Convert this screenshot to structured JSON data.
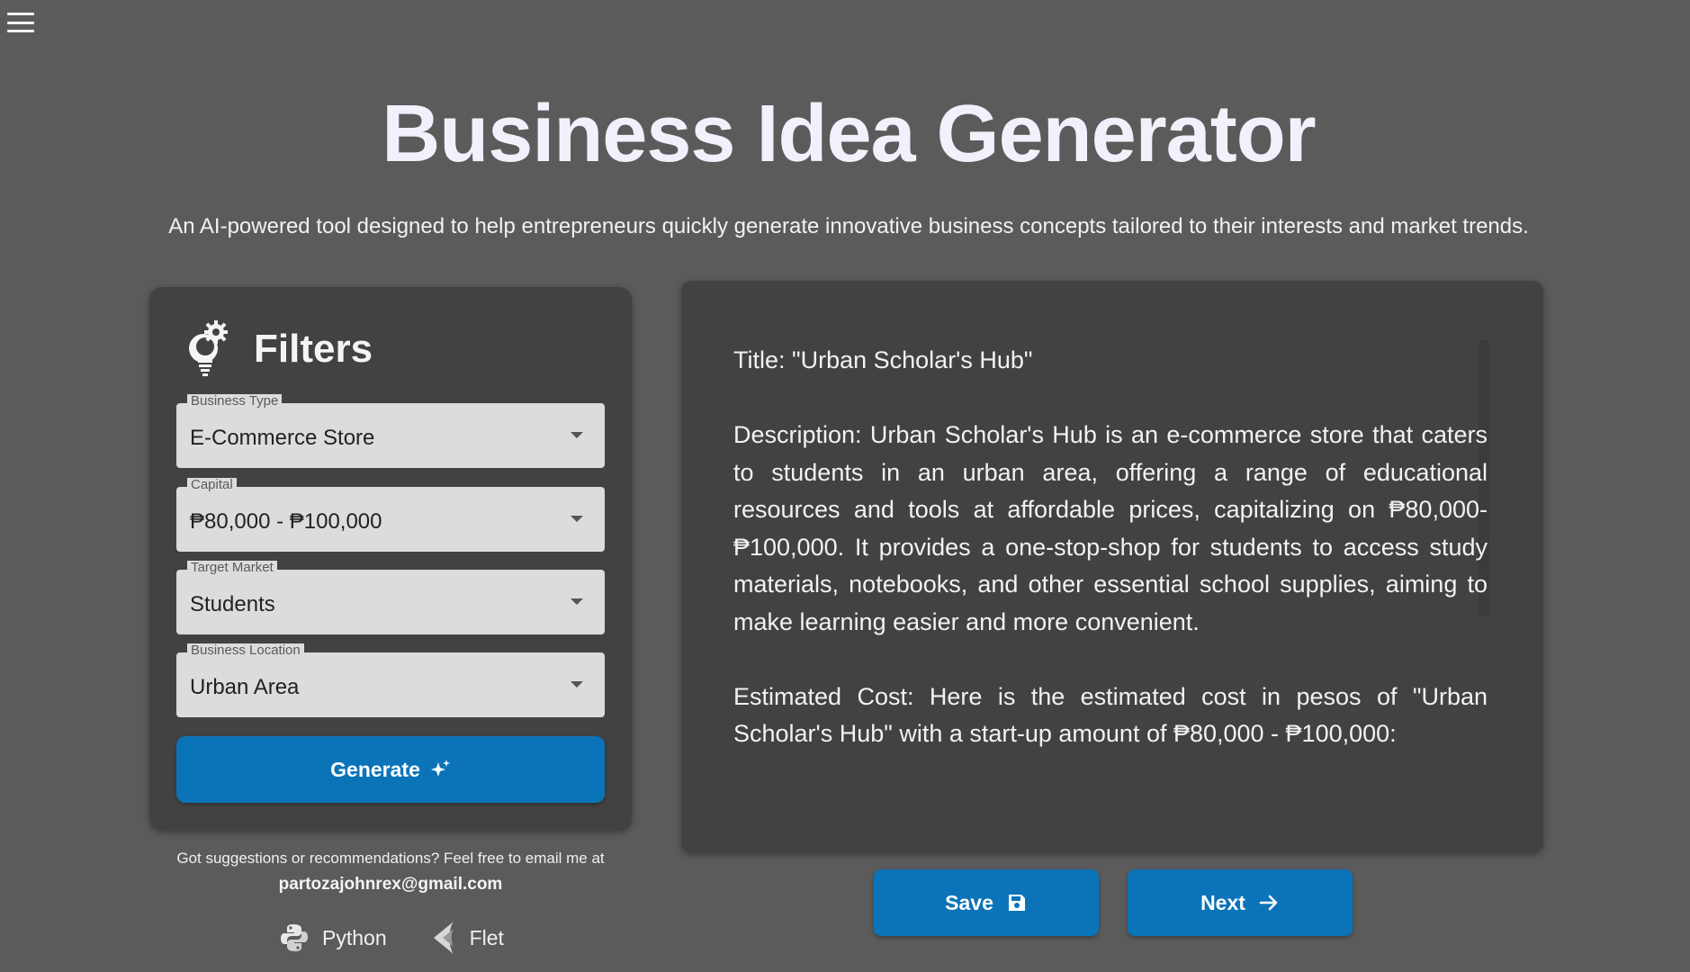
{
  "header": {
    "title": "Business Idea Generator",
    "subtitle": "An AI-powered tool designed to help entrepreneurs quickly generate innovative business concepts tailored to their interests and market trends."
  },
  "filters": {
    "title": "Filters",
    "dropdowns": [
      {
        "label": "Business Type",
        "value": "E-Commerce Store"
      },
      {
        "label": "Capital",
        "value": "₱80,000 - ₱100,000"
      },
      {
        "label": "Target Market",
        "value": "Students"
      },
      {
        "label": "Business Location",
        "value": "Urban Area"
      }
    ],
    "generate_label": "Generate"
  },
  "footer": {
    "contact_text": "Got suggestions or recommendations? Feel free to email me at",
    "email": "partozajohnrex@gmail.com",
    "tech": [
      "Python",
      "Flet"
    ]
  },
  "result": {
    "paragraphs": [
      "Title: \"Urban Scholar's Hub\"",
      "Description: Urban Scholar's Hub is an e-commerce store that caters to students in an urban area, offering a range of educational resources and tools at affordable prices, capitalizing on ₱80,000-₱100,000. It provides a one-stop-shop for students to access study materials, notebooks, and other essential school supplies, aiming to make learning easier and more convenient.",
      "Estimated Cost: Here is the estimated cost in pesos of \"Urban Scholar's Hub\" with a start-up amount of ₱80,000 - ₱100,000:"
    ]
  },
  "actions": {
    "save_label": "Save",
    "next_label": "Next"
  },
  "colors": {
    "background": "#5b5b5b",
    "card": "#424242",
    "accent": "#0b74b8"
  }
}
